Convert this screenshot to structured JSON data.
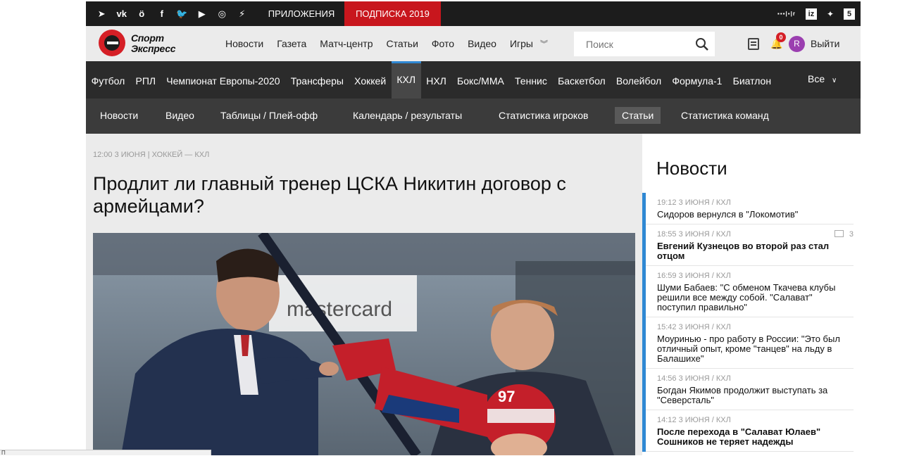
{
  "topbar": {
    "social_icons": [
      "telegram-icon",
      "vk-icon",
      "odnoklassniki-icon",
      "facebook-icon",
      "twitter-icon",
      "youtube-icon",
      "instagram-icon",
      "rss-icon"
    ],
    "social_glyphs": [
      "➤",
      "vk",
      "ö",
      "f",
      "🐦",
      "▶",
      "◎",
      "⚡"
    ],
    "apps_label": "ПРИЛОЖЕНИЯ",
    "subscribe_label": "ПОДПИСКА 2019",
    "partner_logos": [
      "РАМБЛЕР",
      "iz",
      "✦",
      "5"
    ]
  },
  "header": {
    "logo_line1": "Спорт",
    "logo_line2": "Экспресс",
    "nav": [
      "Новости",
      "Газета",
      "Матч-центр",
      "Статьи",
      "Фото",
      "Видео",
      "Игры"
    ],
    "search_placeholder": "Поиск",
    "notifications_count": "0",
    "avatar_letter": "R",
    "logout_label": "Выйти"
  },
  "sport_nav": {
    "items": [
      "Футбол",
      "РПЛ",
      "Чемпионат Европы-2020",
      "Трансферы",
      "Хоккей",
      "КХЛ",
      "НХЛ",
      "Бокс/ММА",
      "Теннис",
      "Баскетбол",
      "Волейбол",
      "Формула-1",
      "Биатлон"
    ],
    "active": "КХЛ",
    "all_label": "Все"
  },
  "sub_nav": {
    "items": [
      "Новости",
      "Видео",
      "Таблицы / Плей-офф",
      "Календарь / результаты",
      "Статистика игроков",
      "Статьи",
      "Статистика команд"
    ],
    "active": "Статьи"
  },
  "article": {
    "meta": "12:00 3 ИЮНЯ | ХОККЕЙ — КХЛ",
    "title": "Продлит ли главный тренер ЦСКА Никитин договор с армейцами?",
    "photo_text_brand": "mastercard",
    "jersey_number": "97"
  },
  "sidebar": {
    "heading": "Новости",
    "news": [
      {
        "meta": "19:12 3 ИЮНЯ  /  КХЛ",
        "title": "Сидоров вернулся в \"Локомотив\"",
        "bold": false,
        "comments": ""
      },
      {
        "meta": "18:55 3 ИЮНЯ  /  КХЛ",
        "title": "Евгений Кузнецов во второй раз стал отцом",
        "bold": true,
        "comments": "3"
      },
      {
        "meta": "16:59 3 ИЮНЯ  /  КХЛ",
        "title": "Шуми Бабаев: \"С обменом Ткачева клубы решили все между собой. \"Салават\" поступил правильно\"",
        "bold": false,
        "comments": ""
      },
      {
        "meta": "15:42 3 ИЮНЯ  /  КХЛ",
        "title": "Моуринью - про работу в России: \"Это был отличный опыт, кроме \"танцев\" на льду в Балашихе\"",
        "bold": false,
        "comments": ""
      },
      {
        "meta": "14:56 3 ИЮНЯ  /  КХЛ",
        "title": "Богдан Якимов продолжит выступать за \"Северсталь\"",
        "bold": false,
        "comments": ""
      },
      {
        "meta": "14:12 3 ИЮНЯ  /  КХЛ",
        "title": "После перехода в \"Салават Юлаев\" Сошников не теряет надежды",
        "bold": true,
        "comments": ""
      }
    ]
  },
  "status_bar": "П"
}
